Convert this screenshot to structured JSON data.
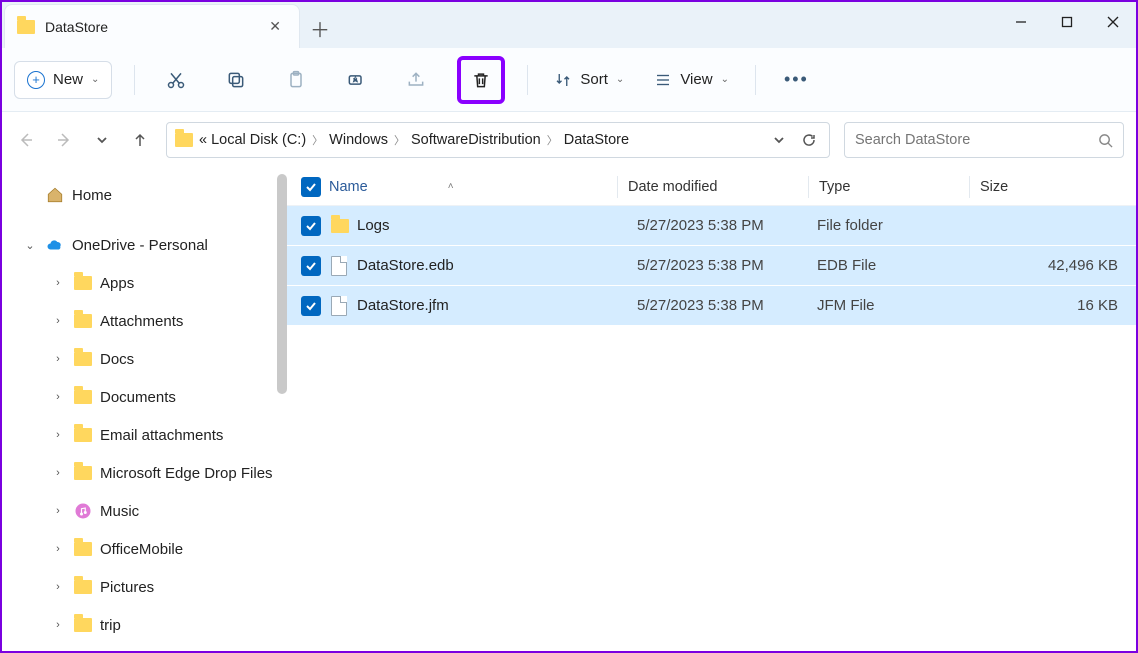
{
  "tab": {
    "title": "DataStore"
  },
  "toolbar": {
    "new_label": "New",
    "sort_label": "Sort",
    "view_label": "View"
  },
  "breadcrumbs": {
    "overflow": "«",
    "items": [
      "Local Disk (C:)",
      "Windows",
      "SoftwareDistribution",
      "DataStore"
    ]
  },
  "search": {
    "placeholder": "Search DataStore"
  },
  "sidebar": {
    "home": "Home",
    "onedrive": "OneDrive - Personal",
    "folders": [
      "Apps",
      "Attachments",
      "Docs",
      "Documents",
      "Email attachments",
      "Microsoft Edge Drop Files",
      "Music",
      "OfficeMobile",
      "Pictures",
      "trip"
    ]
  },
  "columns": {
    "name": "Name",
    "date": "Date modified",
    "type": "Type",
    "size": "Size"
  },
  "files": [
    {
      "name": "Logs",
      "date": "5/27/2023 5:38 PM",
      "type": "File folder",
      "size": "",
      "kind": "folder"
    },
    {
      "name": "DataStore.edb",
      "date": "5/27/2023 5:38 PM",
      "type": "EDB File",
      "size": "42,496 KB",
      "kind": "file"
    },
    {
      "name": "DataStore.jfm",
      "date": "5/27/2023 5:38 PM",
      "type": "JFM File",
      "size": "16 KB",
      "kind": "file"
    }
  ]
}
